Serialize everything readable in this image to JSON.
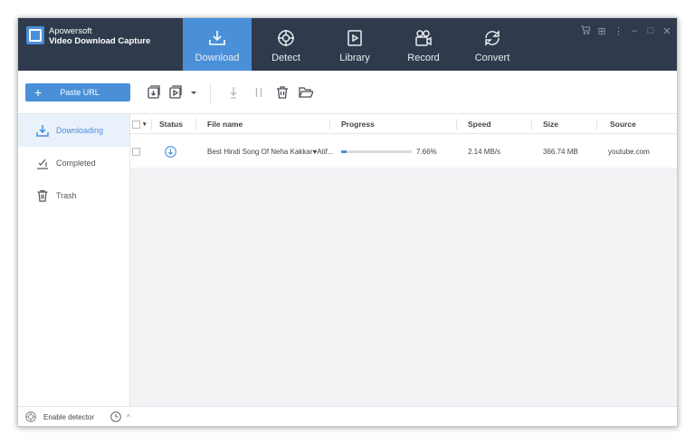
{
  "app": {
    "brand_line1": "Apowersoft",
    "brand_line2": "Video Download Capture",
    "accent_color": "#4a90d9",
    "topbar_color": "#2f3b4c"
  },
  "nav": {
    "tabs": [
      {
        "label": "Download",
        "icon": "download-tray-icon",
        "active": true
      },
      {
        "label": "Detect",
        "icon": "crosshair-icon",
        "active": false
      },
      {
        "label": "Library",
        "icon": "play-box-icon",
        "active": false
      },
      {
        "label": "Record",
        "icon": "video-camera-icon",
        "active": false
      },
      {
        "label": "Convert",
        "icon": "convert-circle-icon",
        "active": false
      }
    ]
  },
  "window_controls": {
    "cart": " ",
    "grid": "⊞",
    "more": "⋮",
    "minimize": "–",
    "maximize": "□",
    "close": "✕"
  },
  "toolbar": {
    "paste_plus": "+",
    "paste_label": "Paste URL"
  },
  "sidebar": {
    "items": [
      {
        "label": "Downloading",
        "icon": "download-icon",
        "active": true
      },
      {
        "label": "Completed",
        "icon": "checklist-icon",
        "active": false
      },
      {
        "label": "Trash",
        "icon": "trash-icon",
        "active": false
      }
    ]
  },
  "table": {
    "headers": {
      "status": "Status",
      "file_name": "File name",
      "progress": "Progress",
      "speed": "Speed",
      "size": "Size",
      "source": "Source"
    },
    "rows": [
      {
        "file_name": "Best Hindi Song Of Neha Kakkar♥Atif...",
        "progress_text": "7.66%",
        "progress_fraction": 0.0766,
        "speed": "2.14 MB/s",
        "size": "366.74 MB",
        "source": "youtube.com"
      }
    ]
  },
  "statusbar": {
    "detector_label": "Enable detector",
    "chevron": "^"
  }
}
